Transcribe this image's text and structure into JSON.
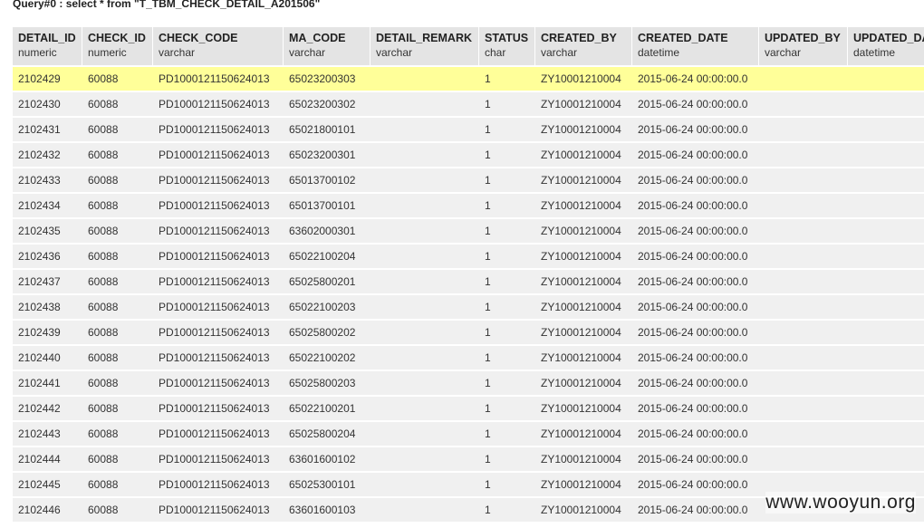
{
  "query_title": "Query#0 : select * from \"T_TBM_CHECK_DETAIL_A201506\"",
  "columns": [
    {
      "name": "DETAIL_ID",
      "type": "numeric"
    },
    {
      "name": "CHECK_ID",
      "type": "numeric"
    },
    {
      "name": "CHECK_CODE",
      "type": "varchar"
    },
    {
      "name": "MA_CODE",
      "type": "varchar"
    },
    {
      "name": "DETAIL_REMARK",
      "type": "varchar"
    },
    {
      "name": "STATUS",
      "type": "char"
    },
    {
      "name": "CREATED_BY",
      "type": "varchar"
    },
    {
      "name": "CREATED_DATE",
      "type": "datetime"
    },
    {
      "name": "UPDATED_BY",
      "type": "varchar"
    },
    {
      "name": "UPDATED_DA",
      "type": "datetime"
    }
  ],
  "rows": [
    [
      "2102429",
      "60088",
      "PD1000121150624013",
      "65023200303",
      "",
      "1",
      "ZY10001210004",
      "2015-06-24 00:00:00.0",
      "",
      ""
    ],
    [
      "2102430",
      "60088",
      "PD1000121150624013",
      "65023200302",
      "",
      "1",
      "ZY10001210004",
      "2015-06-24 00:00:00.0",
      "",
      ""
    ],
    [
      "2102431",
      "60088",
      "PD1000121150624013",
      "65021800101",
      "",
      "1",
      "ZY10001210004",
      "2015-06-24 00:00:00.0",
      "",
      ""
    ],
    [
      "2102432",
      "60088",
      "PD1000121150624013",
      "65023200301",
      "",
      "1",
      "ZY10001210004",
      "2015-06-24 00:00:00.0",
      "",
      ""
    ],
    [
      "2102433",
      "60088",
      "PD1000121150624013",
      "65013700102",
      "",
      "1",
      "ZY10001210004",
      "2015-06-24 00:00:00.0",
      "",
      ""
    ],
    [
      "2102434",
      "60088",
      "PD1000121150624013",
      "65013700101",
      "",
      "1",
      "ZY10001210004",
      "2015-06-24 00:00:00.0",
      "",
      ""
    ],
    [
      "2102435",
      "60088",
      "PD1000121150624013",
      "63602000301",
      "",
      "1",
      "ZY10001210004",
      "2015-06-24 00:00:00.0",
      "",
      ""
    ],
    [
      "2102436",
      "60088",
      "PD1000121150624013",
      "65022100204",
      "",
      "1",
      "ZY10001210004",
      "2015-06-24 00:00:00.0",
      "",
      ""
    ],
    [
      "2102437",
      "60088",
      "PD1000121150624013",
      "65025800201",
      "",
      "1",
      "ZY10001210004",
      "2015-06-24 00:00:00.0",
      "",
      ""
    ],
    [
      "2102438",
      "60088",
      "PD1000121150624013",
      "65022100203",
      "",
      "1",
      "ZY10001210004",
      "2015-06-24 00:00:00.0",
      "",
      ""
    ],
    [
      "2102439",
      "60088",
      "PD1000121150624013",
      "65025800202",
      "",
      "1",
      "ZY10001210004",
      "2015-06-24 00:00:00.0",
      "",
      ""
    ],
    [
      "2102440",
      "60088",
      "PD1000121150624013",
      "65022100202",
      "",
      "1",
      "ZY10001210004",
      "2015-06-24 00:00:00.0",
      "",
      ""
    ],
    [
      "2102441",
      "60088",
      "PD1000121150624013",
      "65025800203",
      "",
      "1",
      "ZY10001210004",
      "2015-06-24 00:00:00.0",
      "",
      ""
    ],
    [
      "2102442",
      "60088",
      "PD1000121150624013",
      "65022100201",
      "",
      "1",
      "ZY10001210004",
      "2015-06-24 00:00:00.0",
      "",
      ""
    ],
    [
      "2102443",
      "60088",
      "PD1000121150624013",
      "65025800204",
      "",
      "1",
      "ZY10001210004",
      "2015-06-24 00:00:00.0",
      "",
      ""
    ],
    [
      "2102444",
      "60088",
      "PD1000121150624013",
      "63601600102",
      "",
      "1",
      "ZY10001210004",
      "2015-06-24 00:00:00.0",
      "",
      ""
    ],
    [
      "2102445",
      "60088",
      "PD1000121150624013",
      "65025300101",
      "",
      "1",
      "ZY10001210004",
      "2015-06-24 00:00:00.0",
      "",
      ""
    ],
    [
      "2102446",
      "60088",
      "PD1000121150624013",
      "63601600103",
      "",
      "1",
      "ZY10001210004",
      "2015-06-24 00:00:00.0",
      "",
      ""
    ]
  ],
  "selected_row_index": 0,
  "colors": {
    "header_bg": "#e4e4e4",
    "row_bg": "#f0f0f0",
    "selected_row_bg": "#ffff99"
  },
  "watermark": "www.wooyun.org"
}
